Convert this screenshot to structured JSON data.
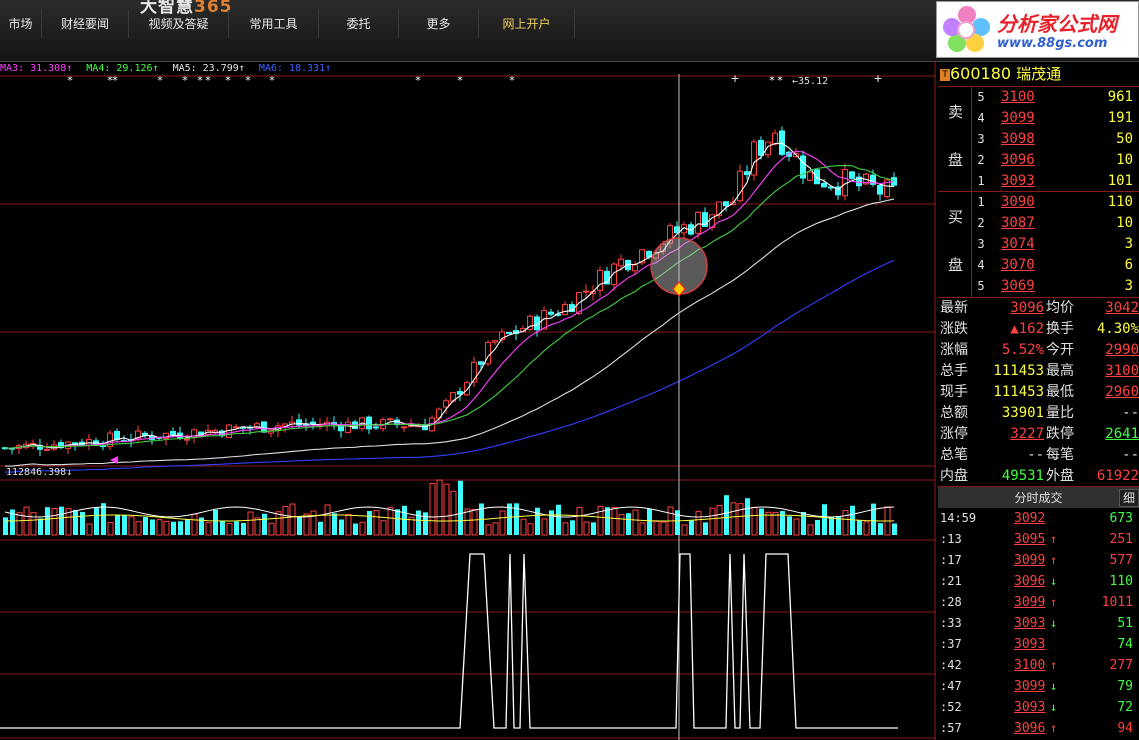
{
  "app": {
    "brand_prefix": "大智慧",
    "brand_suffix": "365"
  },
  "menu": [
    "市场",
    "财经要闻",
    "视频及答疑",
    "常用工具",
    "委托",
    "更多",
    "网上开户"
  ],
  "logo": {
    "name": "分析家公式网",
    "url": "www.88gs.com"
  },
  "ma_legend": [
    {
      "label": "MA3: 31.308↑",
      "color": "#ff40ff"
    },
    {
      "label": "MA4: 29.126↑",
      "color": "#40ff40"
    },
    {
      "label": "MA5: 23.799↑",
      "color": "#e0e0e0"
    },
    {
      "label": "MA6: 18.331↑",
      "color": "#4060ff"
    }
  ],
  "chart_labels": {
    "high": "35.12",
    "volume": "112846.398↓"
  },
  "chart_colors": {
    "up": "#ff4040",
    "down": "#40ffff",
    "ma1": "#ffffff",
    "ma2": "#ff40ff",
    "ma3": "#40d040",
    "ma4": "#e0e0e0",
    "ma5": "#3040ff",
    "grid": "#8a1a1a",
    "signal": "#ffffff"
  },
  "stock": {
    "badge": "T",
    "code": "600180",
    "name": "瑞茂通"
  },
  "orderbook": {
    "sell_label": [
      "卖",
      "盘"
    ],
    "buy_label": [
      "买",
      "盘"
    ],
    "sell": [
      {
        "level": "5",
        "price": "3100",
        "vol": "961"
      },
      {
        "level": "4",
        "price": "3099",
        "vol": "191"
      },
      {
        "level": "3",
        "price": "3098",
        "vol": "50"
      },
      {
        "level": "2",
        "price": "3096",
        "vol": "10"
      },
      {
        "level": "1",
        "price": "3093",
        "vol": "101"
      }
    ],
    "buy": [
      {
        "level": "1",
        "price": "3090",
        "vol": "110"
      },
      {
        "level": "2",
        "price": "3087",
        "vol": "10"
      },
      {
        "level": "3",
        "price": "3074",
        "vol": "3"
      },
      {
        "level": "4",
        "price": "3070",
        "vol": "6"
      },
      {
        "level": "5",
        "price": "3069",
        "vol": "3"
      }
    ]
  },
  "stats": [
    {
      "k1": "最新",
      "v1": "3096",
      "c1": "red",
      "u1": true,
      "k2": "均价",
      "v2": "3042",
      "c2": "red",
      "u2": true
    },
    {
      "k1": "涨跌",
      "v1": "▲162",
      "c1": "red",
      "u1": false,
      "k2": "换手",
      "v2": "4.30%",
      "c2": "yel",
      "u2": false
    },
    {
      "k1": "涨幅",
      "v1": "5.52%",
      "c1": "red",
      "u1": false,
      "k2": "今开",
      "v2": "2990",
      "c2": "red",
      "u2": true
    },
    {
      "k1": "总手",
      "v1": "111453",
      "c1": "yel",
      "u1": false,
      "k2": "最高",
      "v2": "3100",
      "c2": "red",
      "u2": true
    },
    {
      "k1": "现手",
      "v1": "111453",
      "c1": "yel",
      "u1": false,
      "k2": "最低",
      "v2": "2960",
      "c2": "red",
      "u2": true
    },
    {
      "k1": "总额",
      "v1": "33901",
      "c1": "yel",
      "u1": false,
      "k2": "量比",
      "v2": "--",
      "c2": "wht",
      "u2": false
    },
    {
      "k1": "涨停",
      "v1": "3227",
      "c1": "red",
      "u1": true,
      "k2": "跌停",
      "v2": "2641",
      "c2": "grn",
      "u2": true
    },
    {
      "k1": "总笔",
      "v1": "--",
      "c1": "wht",
      "u1": false,
      "k2": "每笔",
      "v2": "--",
      "c2": "wht",
      "u2": false
    },
    {
      "k1": "内盘",
      "v1": "49531",
      "c1": "grn",
      "u1": false,
      "k2": "外盘",
      "v2": "61922",
      "c2": "red",
      "u2": false
    }
  ],
  "ticks_header": {
    "title": "分时成交",
    "detail": "细"
  },
  "ticks": [
    {
      "time": "14:59",
      "price": "3092",
      "arrow": "",
      "vol": "673",
      "vc": "grn"
    },
    {
      "time": ":13",
      "price": "3095",
      "arrow": "↑",
      "vol": "251",
      "vc": "red"
    },
    {
      "time": ":17",
      "price": "3099",
      "arrow": "↑",
      "vol": "577",
      "vc": "red"
    },
    {
      "time": ":21",
      "price": "3096",
      "arrow": "↓",
      "vol": "110",
      "vc": "grn"
    },
    {
      "time": ":28",
      "price": "3099",
      "arrow": "↑",
      "vol": "1011",
      "vc": "red"
    },
    {
      "time": ":33",
      "price": "3093",
      "arrow": "↓",
      "vol": "51",
      "vc": "grn"
    },
    {
      "time": ":37",
      "price": "3093",
      "arrow": "",
      "vol": "74",
      "vc": "grn"
    },
    {
      "time": ":42",
      "price": "3100",
      "arrow": "↑",
      "vol": "277",
      "vc": "red"
    },
    {
      "time": ":47",
      "price": "3099",
      "arrow": "↓",
      "vol": "79",
      "vc": "grn"
    },
    {
      "time": ":52",
      "price": "3093",
      "arrow": "↓",
      "vol": "72",
      "vc": "grn"
    },
    {
      "time": ":57",
      "price": "3096",
      "arrow": "↑",
      "vol": "94",
      "vc": "red"
    }
  ]
}
